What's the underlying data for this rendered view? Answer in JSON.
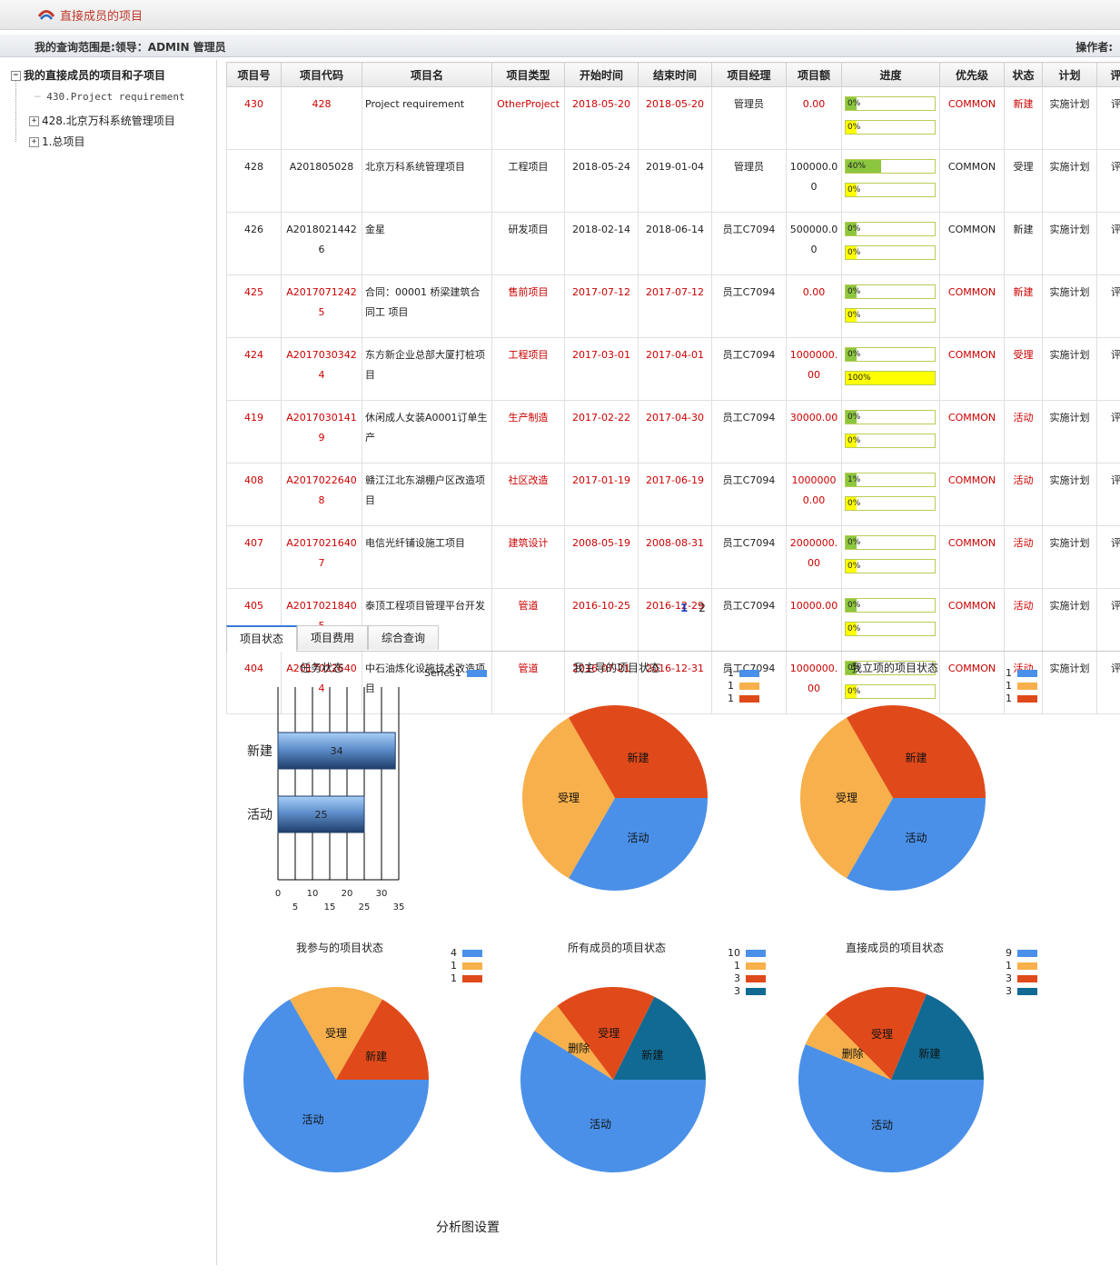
{
  "header": {
    "title": "直接成员的项目"
  },
  "scope": {
    "label": "我的查询范围是:领导：ADMIN 管理员",
    "operator": "操作者:"
  },
  "tree": {
    "root": "我的直接成员的项目和子项目",
    "items": [
      "430.Project requirement",
      "428.北京万科系统管理项目",
      "1.总项目"
    ]
  },
  "table": {
    "headers": [
      "项目号",
      "项目代码",
      "项目名",
      "项目类型",
      "开始时间",
      "结束时间",
      "项目经理",
      "项目额",
      "进度",
      "优先级",
      "状态",
      "计划",
      "评"
    ],
    "rows": [
      {
        "no": "430",
        "code": "428",
        "name": "Project requirement",
        "type": "OtherProject",
        "start": "2018-05-20",
        "end": "2018-05-20",
        "manager": "管理员",
        "amount": "0.00",
        "p1": "0%",
        "p1v": 0,
        "p2": "0%",
        "p2v": 0,
        "priority": "COMMON",
        "status": "新建",
        "plan": "实施计划",
        "eval": "评",
        "red": true
      },
      {
        "no": "428",
        "code": "A201805028",
        "name": "北京万科系统管理项目",
        "type": "工程项目",
        "start": "2018-05-24",
        "end": "2019-01-04",
        "manager": "管理员",
        "amount": "100000.00",
        "p1": "40%",
        "p1v": 40,
        "p2": "0%",
        "p2v": 0,
        "priority": "COMMON",
        "status": "受理",
        "plan": "实施计划",
        "eval": "评",
        "red": false
      },
      {
        "no": "426",
        "code": "A20180214426",
        "name": "金星",
        "type": "研发项目",
        "start": "2018-02-14",
        "end": "2018-06-14",
        "manager": "员工C7094",
        "amount": "500000.00",
        "p1": "0%",
        "p1v": 0,
        "p2": "0%",
        "p2v": 0,
        "priority": "COMMON",
        "status": "新建",
        "plan": "实施计划",
        "eval": "评",
        "red": false
      },
      {
        "no": "425",
        "code": "A20170712425",
        "name": "合同：00001 桥梁建筑合同工 项目",
        "type": "售前项目",
        "start": "2017-07-12",
        "end": "2017-07-12",
        "manager": "员工C7094",
        "amount": "0.00",
        "p1": "0%",
        "p1v": 0,
        "p2": "0%",
        "p2v": 0,
        "priority": "COMMON",
        "status": "新建",
        "plan": "实施计划",
        "eval": "评",
        "red": true
      },
      {
        "no": "424",
        "code": "A20170303424",
        "name": "东方新企业总部大厦打桩项目",
        "type": "工程项目",
        "start": "2017-03-01",
        "end": "2017-04-01",
        "manager": "员工C7094",
        "amount": "1000000.00",
        "p1": "0%",
        "p1v": 0,
        "p2": "100%",
        "p2v": 100,
        "priority": "COMMON",
        "status": "受理",
        "plan": "实施计划",
        "eval": "评",
        "red": true
      },
      {
        "no": "419",
        "code": "A20170301419",
        "name": "休闲成人女装A0001订单生产",
        "type": "生产制造",
        "start": "2017-02-22",
        "end": "2017-04-30",
        "manager": "员工C7094",
        "amount": "30000.00",
        "p1": "0%",
        "p1v": 0,
        "p2": "0%",
        "p2v": 0,
        "priority": "COMMON",
        "status": "活动",
        "plan": "实施计划",
        "eval": "评",
        "red": true
      },
      {
        "no": "408",
        "code": "A20170226408",
        "name": "赣江江北东湖棚户区改造项目",
        "type": "社区改造",
        "start": "2017-01-19",
        "end": "2017-06-19",
        "manager": "员工C7094",
        "amount": "10000000.00",
        "p1": "1%",
        "p1v": 1,
        "p2": "0%",
        "p2v": 0,
        "priority": "COMMON",
        "status": "活动",
        "plan": "实施计划",
        "eval": "评",
        "red": true
      },
      {
        "no": "407",
        "code": "A20170216407",
        "name": "电信光纤铺设施工项目",
        "type": "建筑设计",
        "start": "2008-05-19",
        "end": "2008-08-31",
        "manager": "员工C7094",
        "amount": "2000000.00",
        "p1": "0%",
        "p1v": 0,
        "p2": "0%",
        "p2v": 0,
        "priority": "COMMON",
        "status": "活动",
        "plan": "实施计划",
        "eval": "评",
        "red": true
      },
      {
        "no": "405",
        "code": "A20170218405",
        "name": "泰顶工程项目管理平台开发",
        "type": "管道",
        "start": "2016-10-25",
        "end": "2016-12-29",
        "manager": "员工C7094",
        "amount": "10000.00",
        "p1": "0%",
        "p1v": 0,
        "p2": "0%",
        "p2v": 0,
        "priority": "COMMON",
        "status": "活动",
        "plan": "实施计划",
        "eval": "评",
        "red": true
      },
      {
        "no": "404",
        "code": "A20170226404",
        "name": "中石油炼化设施技术改造项目",
        "type": "管道",
        "start": "2016-07-21",
        "end": "2016-12-31",
        "manager": "员工C7094",
        "amount": "1000000.00",
        "p1": "0%",
        "p1v": 0,
        "p2": "0%",
        "p2v": 0,
        "priority": "COMMON",
        "status": "活动",
        "plan": "实施计划",
        "eval": "评",
        "red": true
      }
    ]
  },
  "pager": {
    "current": "1",
    "next": "2"
  },
  "tabs": [
    "项目状态",
    "项目费用",
    "综合查询"
  ],
  "colors": {
    "blue": "#4a90e8",
    "orange": "#f7b04b",
    "red": "#e04a1a",
    "teal": "#106a93",
    "progress1": "#8cc63f",
    "progress2": "#ffff00"
  },
  "chart_data": [
    {
      "type": "bar",
      "title": "任务状态",
      "categories": [
        "新建",
        "活动"
      ],
      "series": [
        {
          "name": "Series1",
          "values": [
            34,
            25
          ]
        }
      ],
      "xlim": [
        0,
        35
      ],
      "ticks_top": [
        "0",
        "10",
        "20",
        "30"
      ],
      "ticks_bottom": [
        "5",
        "15",
        "25",
        "35"
      ]
    },
    {
      "type": "pie",
      "title": "我主导的项目状态",
      "slices": [
        {
          "label": "活动",
          "value": 1
        },
        {
          "label": "受理",
          "value": 1
        },
        {
          "label": "新建",
          "value": 1
        }
      ],
      "legend": [
        "1",
        "1",
        "1"
      ]
    },
    {
      "type": "pie",
      "title": "我立项的项目状态",
      "slices": [
        {
          "label": "活动",
          "value": 1
        },
        {
          "label": "受理",
          "value": 1
        },
        {
          "label": "新建",
          "value": 1
        }
      ],
      "legend": [
        "1",
        "1",
        "1"
      ]
    },
    {
      "type": "pie",
      "title": "我参与的项目状态",
      "slices": [
        {
          "label": "活动",
          "value": 4
        },
        {
          "label": "受理",
          "value": 1
        },
        {
          "label": "新建",
          "value": 1
        }
      ],
      "legend": [
        "4",
        "1",
        "1"
      ]
    },
    {
      "type": "pie",
      "title": "所有成员的项目状态",
      "slices": [
        {
          "label": "活动",
          "value": 10
        },
        {
          "label": "删除",
          "value": 1
        },
        {
          "label": "受理",
          "value": 3
        },
        {
          "label": "新建",
          "value": 3
        }
      ],
      "legend": [
        "10",
        "1",
        "3",
        "3"
      ]
    },
    {
      "type": "pie",
      "title": "直接成员的项目状态",
      "slices": [
        {
          "label": "活动",
          "value": 9
        },
        {
          "label": "删除",
          "value": 1
        },
        {
          "label": "受理",
          "value": 3
        },
        {
          "label": "新建",
          "value": 3
        }
      ],
      "legend": [
        "9",
        "1",
        "3",
        "3"
      ]
    }
  ],
  "footer": {
    "settings": "分析图设置"
  }
}
